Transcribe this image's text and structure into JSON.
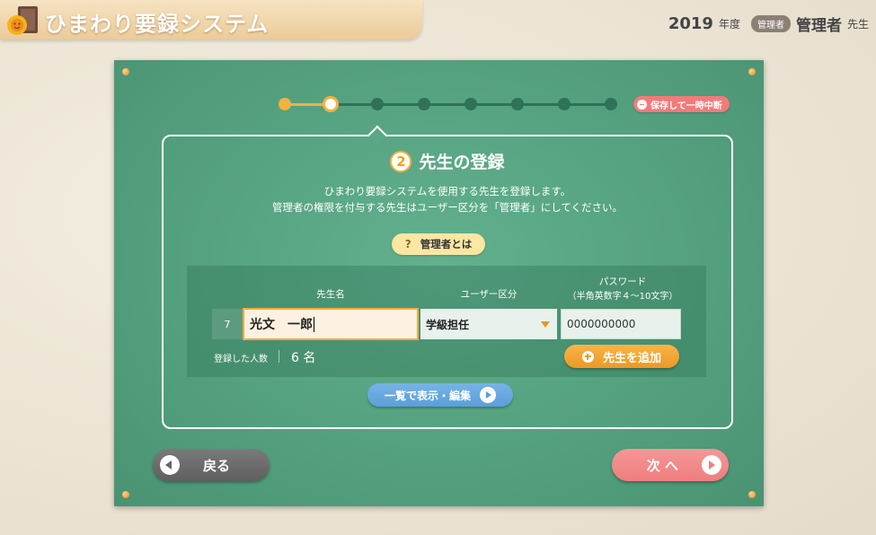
{
  "header": {
    "app_title": "ひまわり要録システム",
    "logo_icon": "sunflower-book-icon",
    "year": "2019",
    "year_unit": "年度",
    "role_badge": "管理者",
    "user_name": "管理者",
    "user_suffix": "先生"
  },
  "progress": {
    "total_steps": 8,
    "current_step": 2,
    "pause_label": "保存して一時中断"
  },
  "step": {
    "number": "2",
    "title": "先生の登録",
    "description_line1": "ひまわり要録システムを使用する先生を登録します。",
    "description_line2": "管理者の権限を付与する先生はユーザー区分を「管理者」にしてください。",
    "help_label": "管理者とは",
    "help_icon": "?"
  },
  "form": {
    "col_name": "先生名",
    "col_type": "ユーザー区分",
    "col_password": "パスワード",
    "col_password_hint": "（半角英数字４～10文字）",
    "row_number": "7",
    "name_value": "光文　一郎",
    "type_value": "学級担任",
    "password_value": "0000000000",
    "count_label": "登録した人数",
    "count_value": "6 名",
    "add_label": "先生を追加"
  },
  "list_button": "一覧で表示・編集",
  "nav": {
    "back_label": "戻る",
    "next_label": "次 へ"
  },
  "colors": {
    "board": "#519d7b",
    "accent_orange": "#f5b13e",
    "next_pink": "#ef7e7e",
    "list_blue": "#5a9fda"
  }
}
